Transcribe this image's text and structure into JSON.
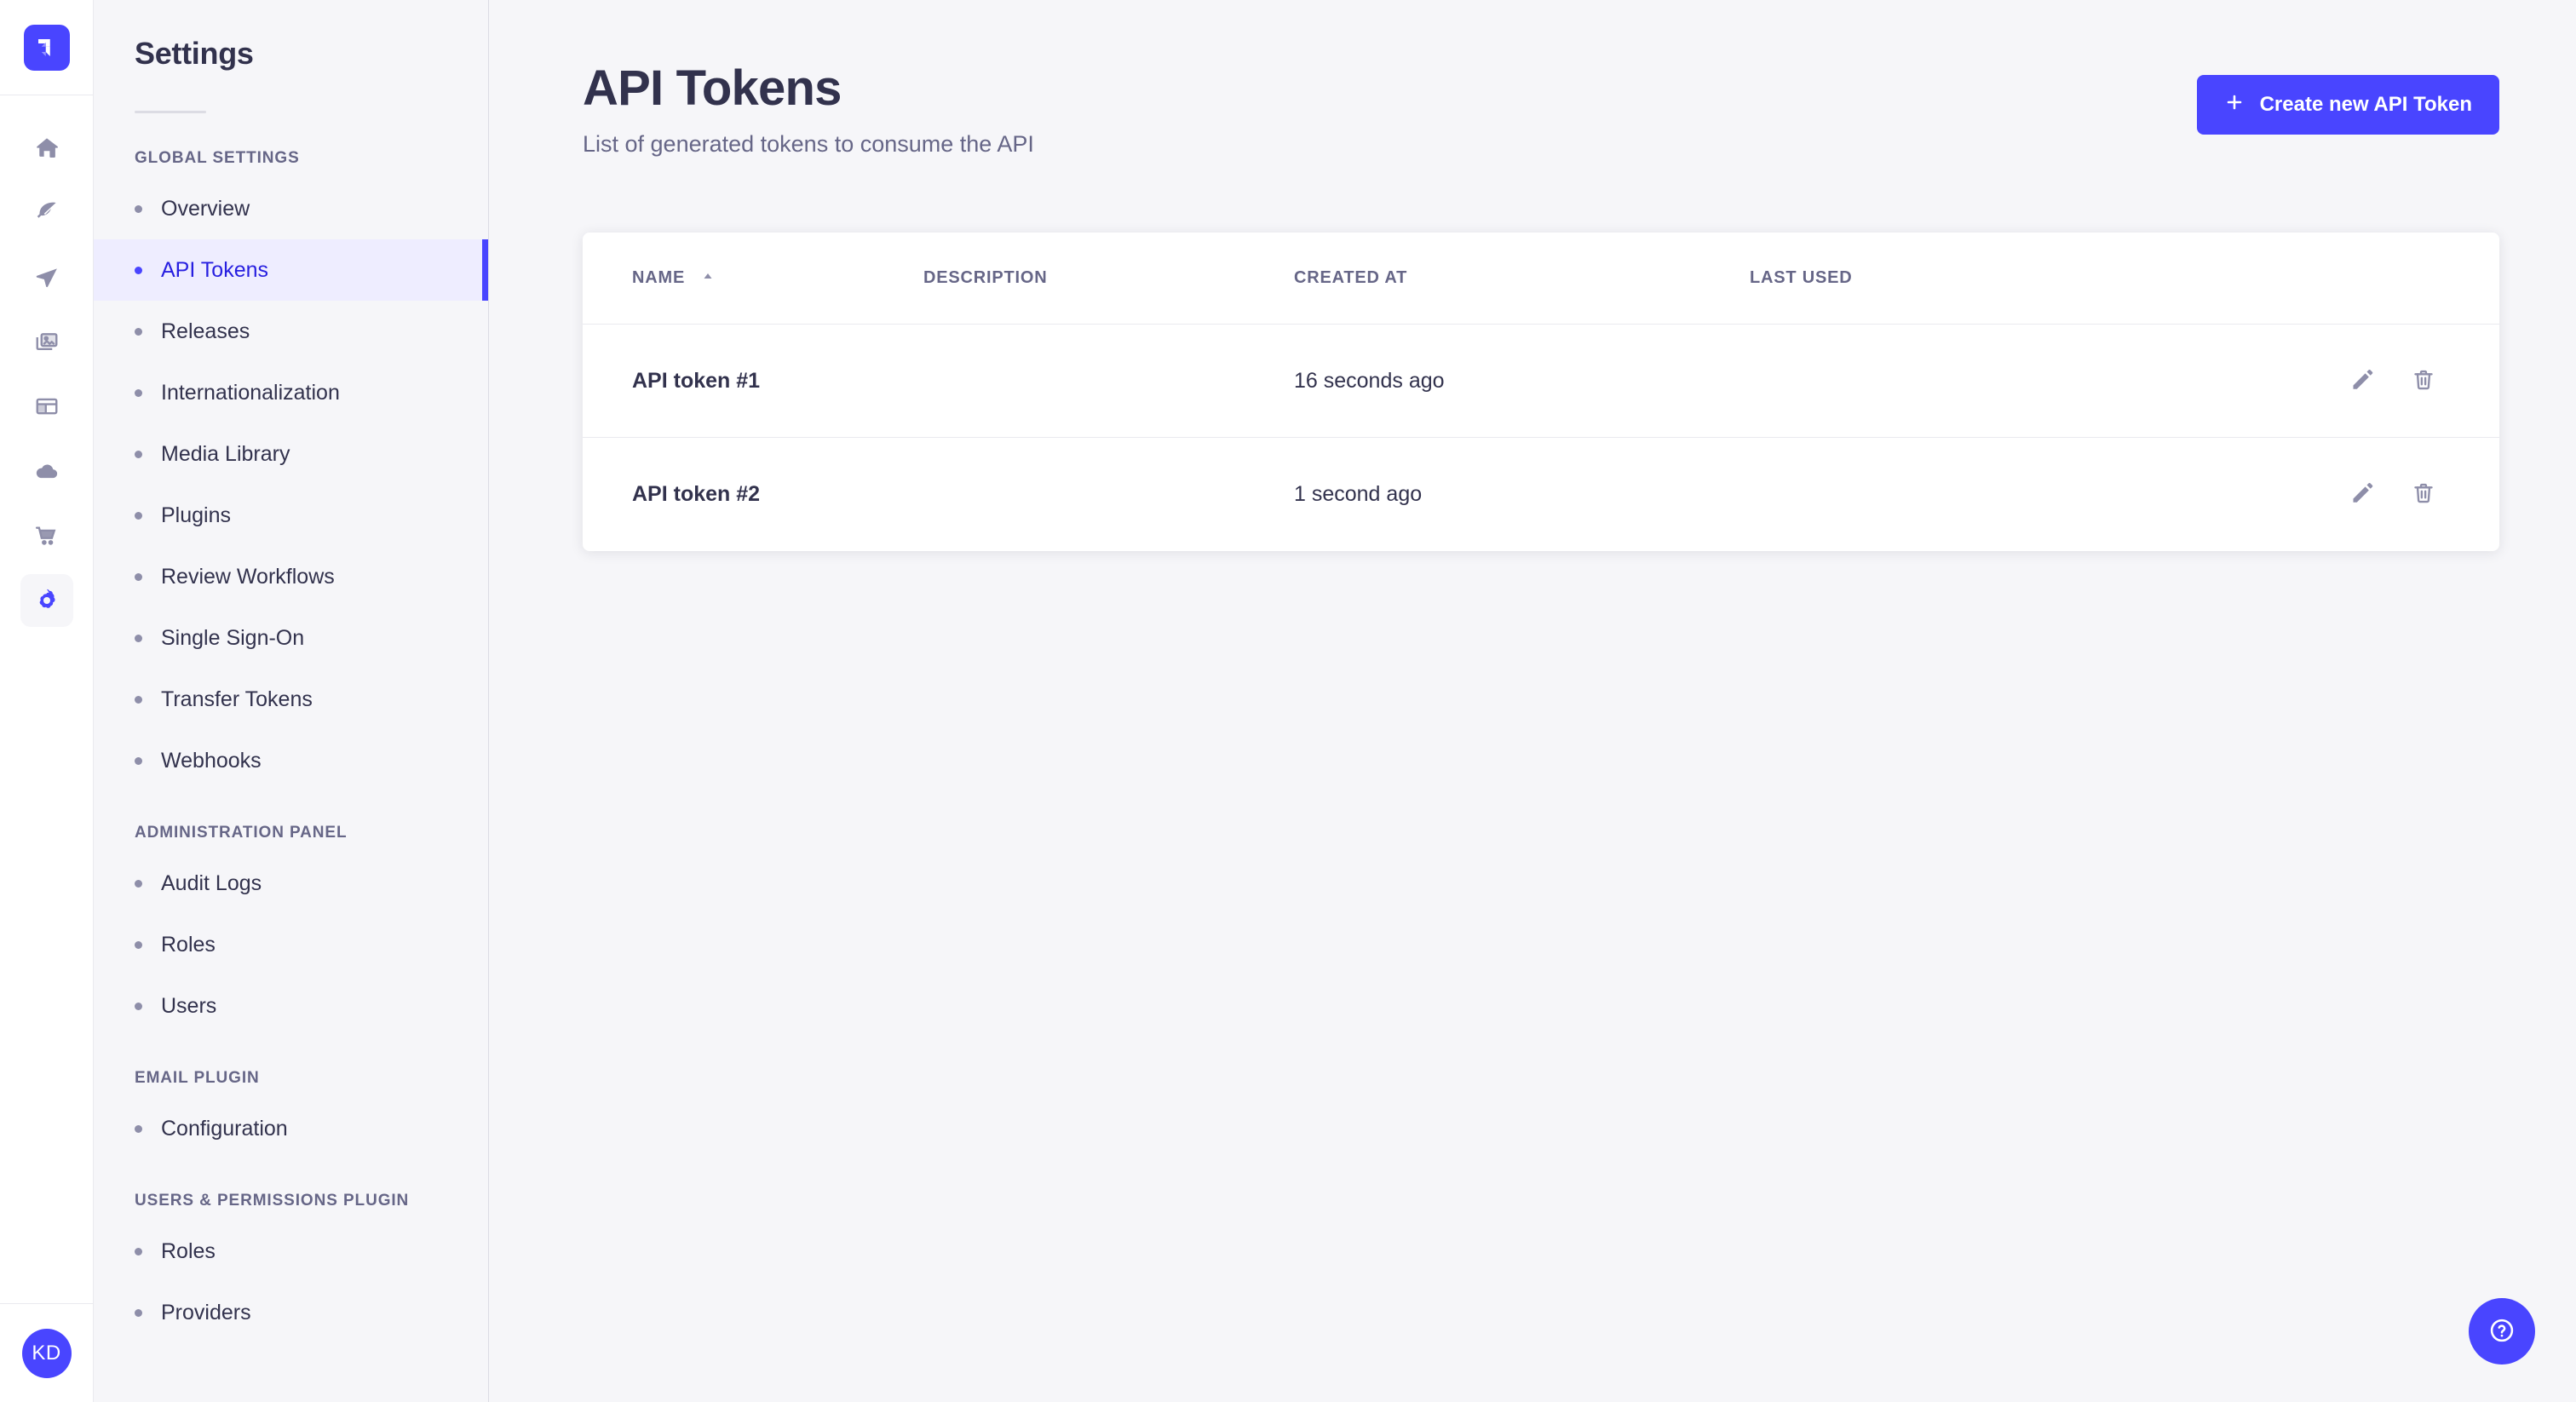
{
  "brand": {
    "logo_icon": "strapi-logo-icon",
    "accent_color": "#4945ff",
    "active_nav_bg": "#eeedff",
    "active_nav_text": "#271fe0"
  },
  "rail": {
    "items": [
      {
        "icon": "home-icon",
        "name": "home"
      },
      {
        "icon": "feather-icon",
        "name": "content-manager"
      },
      {
        "icon": "paper-plane-icon",
        "name": "content-type-builder"
      },
      {
        "icon": "images-icon",
        "name": "media-library"
      },
      {
        "icon": "layout-icon",
        "name": "pages"
      },
      {
        "icon": "cloud-icon",
        "name": "cloud"
      },
      {
        "icon": "cart-icon",
        "name": "marketplace"
      },
      {
        "icon": "gear-icon",
        "name": "settings",
        "active": true
      }
    ],
    "avatar_initials": "KD"
  },
  "sidebar": {
    "title": "Settings",
    "sections": [
      {
        "title": "GLOBAL SETTINGS",
        "items": [
          {
            "label": "Overview",
            "active": false
          },
          {
            "label": "API Tokens",
            "active": true
          },
          {
            "label": "Releases",
            "active": false
          },
          {
            "label": "Internationalization",
            "active": false
          },
          {
            "label": "Media Library",
            "active": false
          },
          {
            "label": "Plugins",
            "active": false
          },
          {
            "label": "Review Workflows",
            "active": false
          },
          {
            "label": "Single Sign-On",
            "active": false
          },
          {
            "label": "Transfer Tokens",
            "active": false
          },
          {
            "label": "Webhooks",
            "active": false
          }
        ]
      },
      {
        "title": "ADMINISTRATION PANEL",
        "items": [
          {
            "label": "Audit Logs",
            "active": false
          },
          {
            "label": "Roles",
            "active": false
          },
          {
            "label": "Users",
            "active": false
          }
        ]
      },
      {
        "title": "EMAIL PLUGIN",
        "items": [
          {
            "label": "Configuration",
            "active": false
          }
        ]
      },
      {
        "title": "USERS & PERMISSIONS PLUGIN",
        "items": [
          {
            "label": "Roles",
            "active": false
          },
          {
            "label": "Providers",
            "active": false
          }
        ]
      }
    ]
  },
  "main": {
    "title": "API Tokens",
    "subtitle": "List of generated tokens to consume the API",
    "create_button": {
      "label": "Create new API Token",
      "icon": "plus-icon"
    },
    "table": {
      "columns": [
        {
          "label": "NAME",
          "sorted": true,
          "sort_direction": "asc"
        },
        {
          "label": "DESCRIPTION",
          "sorted": false
        },
        {
          "label": "CREATED AT",
          "sorted": false
        },
        {
          "label": "LAST USED",
          "sorted": false
        }
      ],
      "rows": [
        {
          "name": "API token #1",
          "description": "",
          "created_at": "16 seconds ago",
          "last_used": "",
          "edit_icon": "pencil-icon",
          "delete_icon": "trash-icon"
        },
        {
          "name": "API token #2",
          "description": "",
          "created_at": "1 second ago",
          "last_used": "",
          "edit_icon": "pencil-icon",
          "delete_icon": "trash-icon"
        }
      ]
    },
    "help_button": {
      "icon": "question-circle-icon"
    }
  }
}
